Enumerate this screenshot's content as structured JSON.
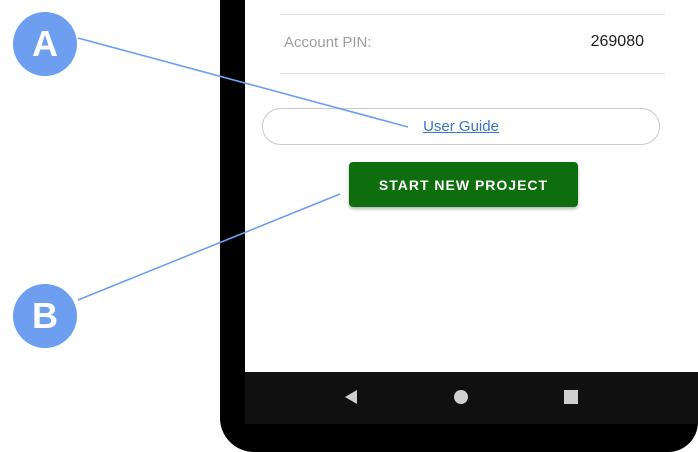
{
  "account": {
    "pin_label": "Account PIN:",
    "pin_value": "269080"
  },
  "user_guide_label": "User Guide",
  "start_button_label": "START NEW PROJECT",
  "annotations": {
    "marker_a": "A",
    "marker_b": "B"
  },
  "nav_bar": {
    "icons": [
      "back-icon",
      "home-icon",
      "recents-icon"
    ]
  },
  "colors": {
    "start_button": "#0e6e0e",
    "link": "#3b74c9",
    "marker": "#6d9ef0",
    "callout_line": "#6d9ef0"
  }
}
